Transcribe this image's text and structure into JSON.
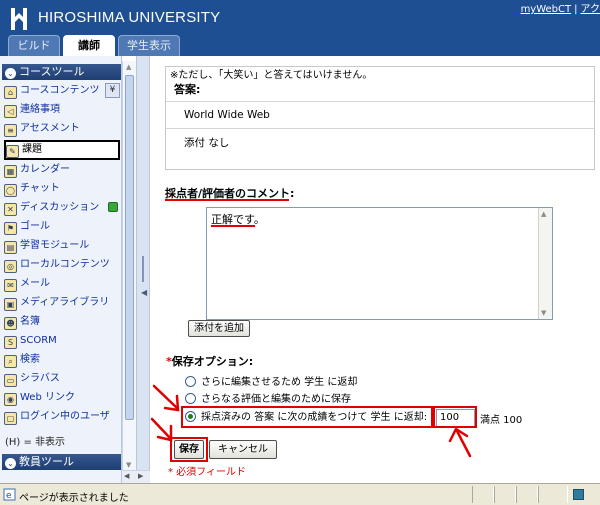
{
  "header": {
    "university": "HIROSHIMA UNIVERSITY",
    "top_link_1": "myWebCT",
    "top_sep": "|",
    "top_link_2": "アク"
  },
  "role_tabs": [
    {
      "label": "ビルド",
      "active": false
    },
    {
      "label": "講師",
      "active": true
    },
    {
      "label": "学生表示",
      "active": false
    }
  ],
  "sidebar": {
    "course_tools_title": "コースツール",
    "items": [
      {
        "label": "コースコンテンツ",
        "icon": "home-icon"
      },
      {
        "label": "連絡事項",
        "icon": "megaphone-icon"
      },
      {
        "label": "アセスメント",
        "icon": "clipboard-icon"
      },
      {
        "label": "課題",
        "icon": "assignment-icon"
      },
      {
        "label": "カレンダー",
        "icon": "calendar-icon"
      },
      {
        "label": "チャット",
        "icon": "chat-icon"
      },
      {
        "label": "ディスカッション",
        "icon": "discussion-icon"
      },
      {
        "label": "ゴール",
        "icon": "goal-icon"
      },
      {
        "label": "学習モジュール",
        "icon": "module-icon"
      },
      {
        "label": "ローカルコンテンツ",
        "icon": "local-content-icon"
      },
      {
        "label": "メール",
        "icon": "mail-icon"
      },
      {
        "label": "メディアライブラリ",
        "icon": "media-library-icon"
      },
      {
        "label": "名簿",
        "icon": "roster-icon"
      },
      {
        "label": "SCORM",
        "icon": "scorm-icon"
      },
      {
        "label": "検索",
        "icon": "search-icon"
      },
      {
        "label": "シラバス",
        "icon": "syllabus-icon"
      },
      {
        "label": "Web リンク",
        "icon": "web-link-icon"
      },
      {
        "label": "ログイン中のユーザ",
        "icon": "users-online-icon"
      }
    ],
    "selected_index": 3,
    "hide_note": "(H) = 非表示",
    "instructor_tools_title": "教員ツール"
  },
  "answer": {
    "note": "※ただし、「大笑い」と答えてはいけません。",
    "label": "答案:",
    "text": "World Wide Web",
    "attachment": "添付 なし"
  },
  "comment": {
    "label": "採点者/評価者のコメント:",
    "text": "正解です。"
  },
  "add_attachment_button": "添付を追加",
  "save_options": {
    "required_mark": "*",
    "label": "保存オプション:",
    "options": [
      "さらに編集させるため 学生 に返却",
      "さらなる評価と編集のために保存",
      "採点済みの 答案 に次の成績をつけて 学生 に返却:"
    ],
    "selected_index": 2,
    "grade_value": "100",
    "max_score": "満点 100"
  },
  "buttons": {
    "save": "保存",
    "cancel": "キャンセル"
  },
  "required_note": "* 必須フィールド",
  "status": {
    "text": "ページが表示されました"
  },
  "colors": {
    "header_blue": "#1d4f92",
    "annotation_red": "#e00000",
    "link_blue": "#0c2fa0"
  }
}
